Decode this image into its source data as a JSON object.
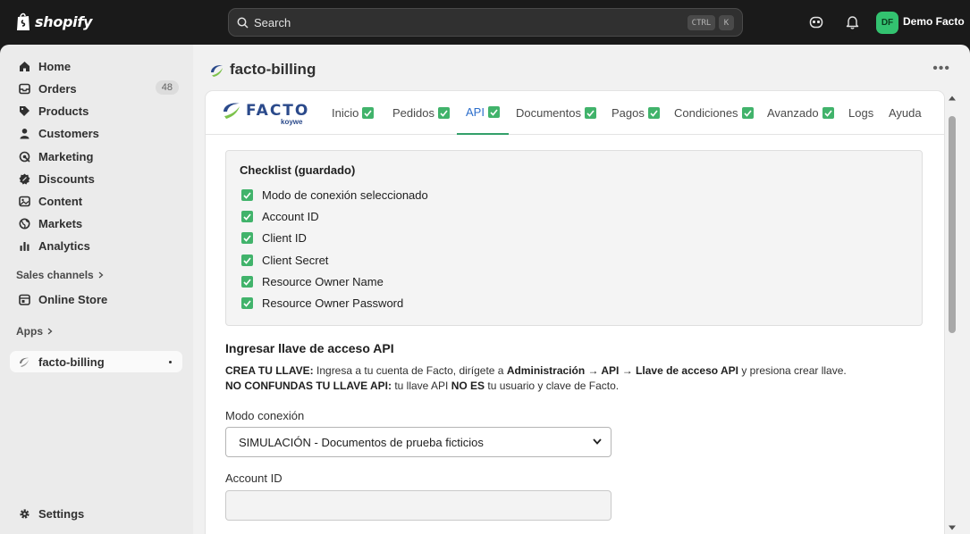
{
  "topbar": {
    "logo_text": "shopify",
    "search_placeholder": "Search",
    "shortcut_ctrl": "CTRL",
    "shortcut_k": "K",
    "avatar_initials": "DF",
    "store_name": "Demo Facto"
  },
  "sidebar": {
    "items": [
      {
        "label": "Home",
        "icon": "home-icon"
      },
      {
        "label": "Orders",
        "icon": "orders-icon",
        "badge": "48"
      },
      {
        "label": "Products",
        "icon": "tag-icon"
      },
      {
        "label": "Customers",
        "icon": "person-icon"
      },
      {
        "label": "Marketing",
        "icon": "target-icon"
      },
      {
        "label": "Discounts",
        "icon": "discount-icon"
      },
      {
        "label": "Content",
        "icon": "image-icon"
      },
      {
        "label": "Markets",
        "icon": "globe-icon"
      },
      {
        "label": "Analytics",
        "icon": "chart-icon"
      }
    ],
    "sales_channels_header": "Sales channels",
    "online_store": "Online Store",
    "apps_header": "Apps",
    "app_item": "facto-billing",
    "settings": "Settings"
  },
  "main": {
    "app_title": "facto-billing",
    "facto_logo_word": "FACTO",
    "facto_logo_sub": "koywe",
    "tabs": [
      {
        "label": "Inicio",
        "checked": true
      },
      {
        "label": "Pedidos",
        "checked": true
      },
      {
        "label": "API",
        "checked": true,
        "active": true
      },
      {
        "label": "Documentos",
        "checked": true
      },
      {
        "label": "Pagos",
        "checked": true
      },
      {
        "label": "Condiciones",
        "checked": true
      },
      {
        "label": "Avanzado",
        "checked": true
      },
      {
        "label": "Logs",
        "checked": false
      },
      {
        "label": "Ayuda",
        "checked": false
      }
    ],
    "checklist": {
      "title": "Checklist (guardado)",
      "items": [
        "Modo de conexión seleccionado",
        "Account ID",
        "Client ID",
        "Client Secret",
        "Resource Owner Name",
        "Resource Owner Password"
      ]
    },
    "api_section": {
      "title": "Ingresar llave de acceso API",
      "line1_bold": "CREA TU LLAVE:",
      "line1_text": " Ingresa a tu cuenta de Facto, dirígete a ",
      "line1_path": "Administración → API → Llave de acceso API",
      "line1_end": " y presiona crear llave.",
      "line2_bold": "NO CONFUNDAS TU LLAVE API:",
      "line2_text": " tu llave API ",
      "line2_bold2": "NO ES",
      "line2_end": " tu usuario y clave de Facto.",
      "mode_label": "Modo conexión",
      "mode_value": "SIMULACIÓN - Documentos de prueba ficticios",
      "account_label": "Account ID",
      "account_value": ""
    }
  },
  "colors": {
    "accent_green": "#41b36b",
    "active_tab": "#2c6ecb",
    "facto_blue": "#2b4a8b"
  }
}
